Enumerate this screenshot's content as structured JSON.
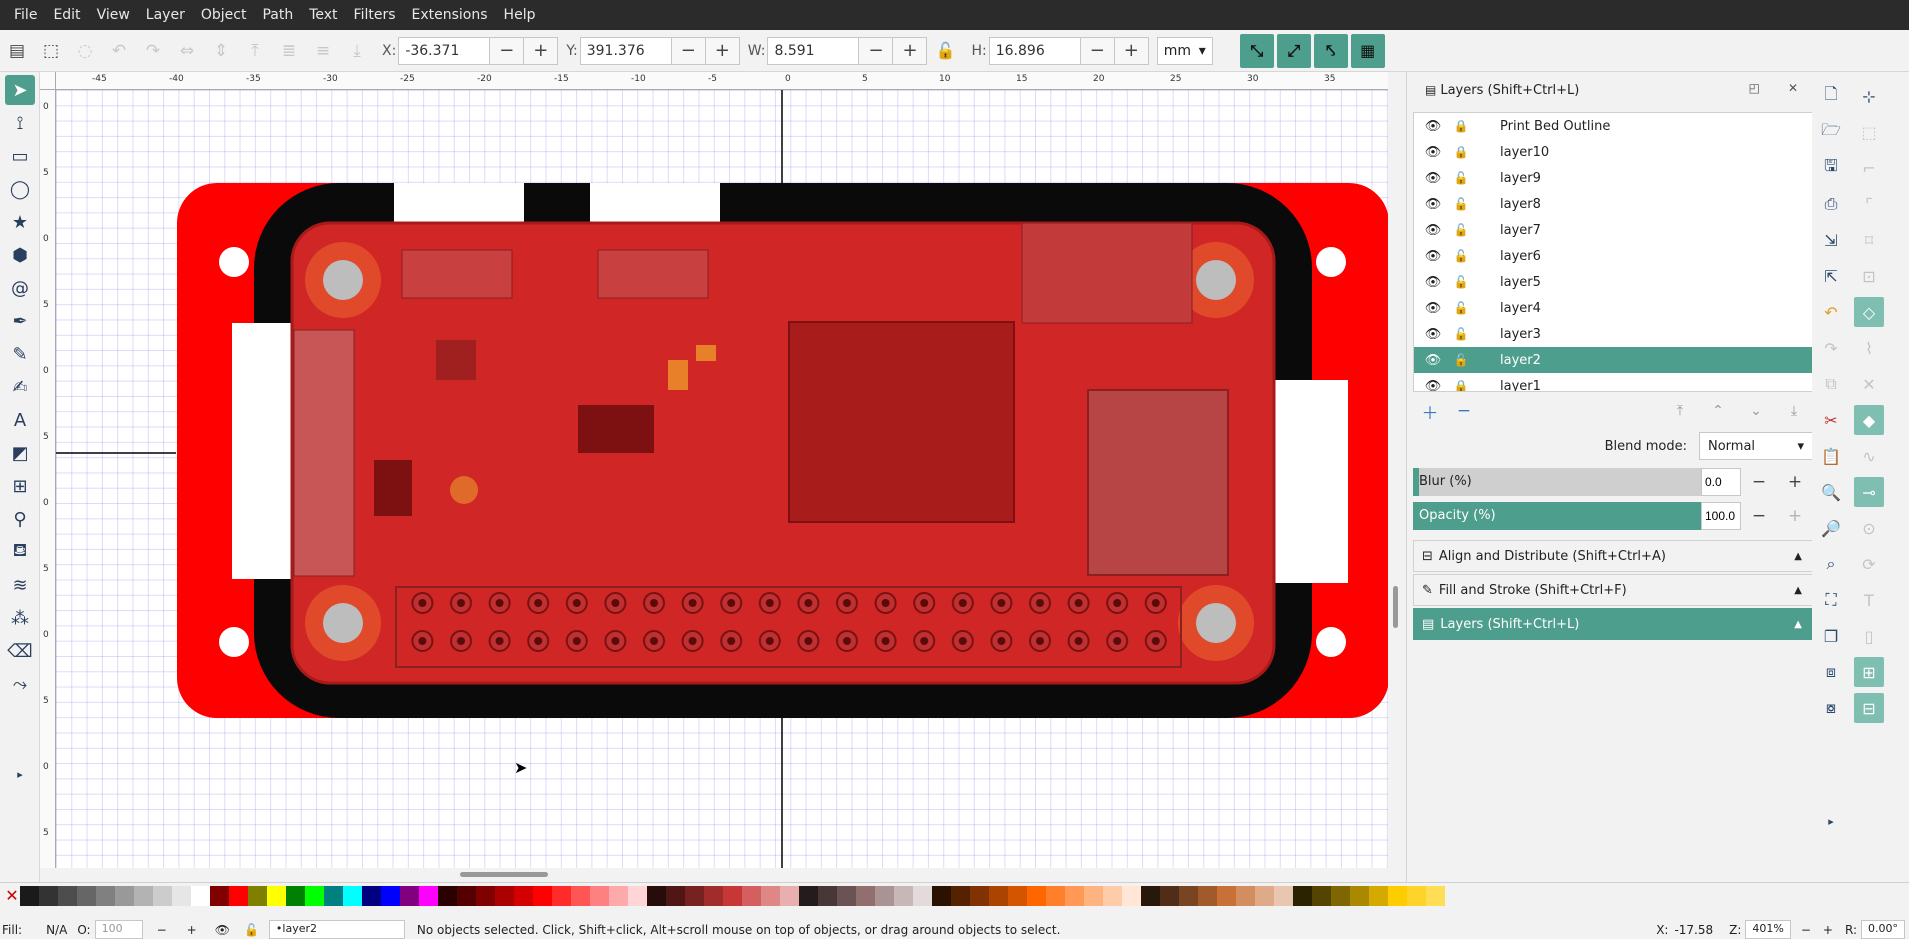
{
  "menubar": {
    "items": [
      "File",
      "Edit",
      "View",
      "Layer",
      "Object",
      "Path",
      "Text",
      "Filters",
      "Extensions",
      "Help"
    ]
  },
  "toolbar": {
    "x": {
      "label": "X:",
      "value": "-36.371"
    },
    "y": {
      "label": "Y:",
      "value": "391.376"
    },
    "w": {
      "label": "W:",
      "value": "8.591"
    },
    "h": {
      "label": "H:",
      "value": "16.896"
    },
    "unit": "mm",
    "minus": "−",
    "plus": "+"
  },
  "ruler": {
    "h_ticks": [
      "-45",
      "-40",
      "-35",
      "-30",
      "-25",
      "-20",
      "-15",
      "-10",
      "-5",
      "0",
      "5",
      "10",
      "15",
      "20",
      "25",
      "30",
      "35"
    ],
    "v_ticks": [
      "0",
      "5",
      "0",
      "5",
      "0",
      "5",
      "0",
      "5",
      "0",
      "5",
      "0",
      "5"
    ]
  },
  "layers_panel": {
    "title": "Layers (Shift+Ctrl+L)",
    "layers": [
      {
        "name": "Print Bed Outline",
        "locked": true,
        "selected": false
      },
      {
        "name": "layer10",
        "locked": true,
        "selected": false
      },
      {
        "name": "layer9",
        "locked": false,
        "selected": false
      },
      {
        "name": "layer8",
        "locked": false,
        "selected": false
      },
      {
        "name": "layer7",
        "locked": false,
        "selected": false
      },
      {
        "name": "layer6",
        "locked": false,
        "selected": false
      },
      {
        "name": "layer5",
        "locked": false,
        "selected": false
      },
      {
        "name": "layer4",
        "locked": false,
        "selected": false
      },
      {
        "name": "layer3",
        "locked": false,
        "selected": false
      },
      {
        "name": "layer2",
        "locked": false,
        "selected": true
      },
      {
        "name": "layer1",
        "locked": true,
        "selected": false
      }
    ],
    "blend_label": "Blend mode:",
    "blend_value": "Normal",
    "blur": {
      "label": "Blur (%)",
      "value": "0.0"
    },
    "opacity": {
      "label": "Opacity (%)",
      "value": "100.0"
    }
  },
  "docked": {
    "align": "Align and Distribute (Shift+Ctrl+A)",
    "fill": "Fill and Stroke (Shift+Ctrl+F)",
    "layers": "Layers (Shift+Ctrl+L)"
  },
  "palette": {
    "colors": [
      "#1a1a1a",
      "#333333",
      "#4d4d4d",
      "#666666",
      "#808080",
      "#999999",
      "#b3b3b3",
      "#cccccc",
      "#e6e6e6",
      "#ffffff",
      "#800000",
      "#ff0000",
      "#808000",
      "#ffff00",
      "#008000",
      "#00ff00",
      "#008080",
      "#00ffff",
      "#000080",
      "#0000ff",
      "#800080",
      "#ff00ff",
      "#2b0000",
      "#550000",
      "#800000",
      "#aa0000",
      "#d40000",
      "#ff0000",
      "#ff2a2a",
      "#ff5555",
      "#ff8080",
      "#ffaaaa",
      "#ffd5d5",
      "#280b0b",
      "#501616",
      "#782121",
      "#a02c2c",
      "#c83737",
      "#d35f5f",
      "#de8787",
      "#e9afaf",
      "#241c1c",
      "#483737",
      "#6c5353",
      "#916f6f",
      "#ac9393",
      "#c8b7b7",
      "#e3dbdb",
      "#2b1100",
      "#552200",
      "#803300",
      "#aa4400",
      "#d45500",
      "#ff6600",
      "#ff7f2a",
      "#ff9955",
      "#ffb380",
      "#ffccaa",
      "#ffe6d5",
      "#28170b",
      "#502d16",
      "#784421",
      "#a05a2c",
      "#c87137",
      "#d38d5f",
      "#deaa87",
      "#e9c6af",
      "#2b2200",
      "#554400",
      "#806600",
      "#aa8800",
      "#d4aa00",
      "#ffcc00",
      "#ffd42a",
      "#ffdd55"
    ]
  },
  "status": {
    "fill_label": "Fill:",
    "fill_value": "N/A",
    "opacity_label": "O:",
    "opacity_value": "100",
    "layer_value": "•layer2",
    "message": "No objects selected. Click, Shift+click, Alt+scroll mouse on top of objects, or drag around objects to select.",
    "x_label": "X:",
    "x_value": "-17.58",
    "zoom_label": "Z:",
    "zoom_value": "401%",
    "rot_label": "R:",
    "rot_value": "0.00°"
  }
}
